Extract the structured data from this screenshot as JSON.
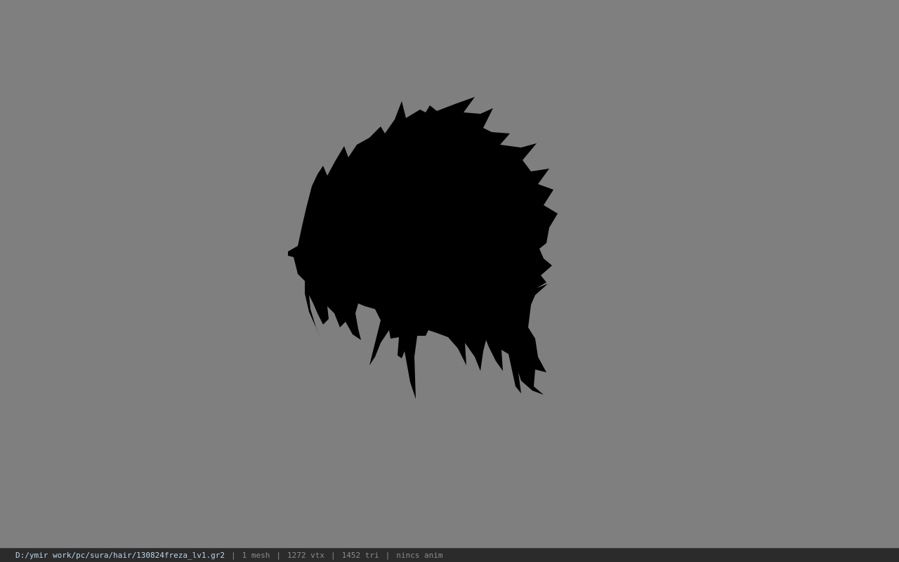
{
  "viewport": {
    "background_color": "#7f7f7f",
    "model_color": "#000000"
  },
  "statusbar": {
    "file_path": "D:/ymir work/pc/sura/hair/130824freza_lv1.gr2",
    "separator": "|",
    "mesh_count": "1 mesh",
    "vertex_count": "1272 vtx",
    "triangle_count": "1452 tri",
    "anim_status": "nincs anim",
    "path_color": "#b9d4e8",
    "text_color": "#8a8a8a"
  }
}
